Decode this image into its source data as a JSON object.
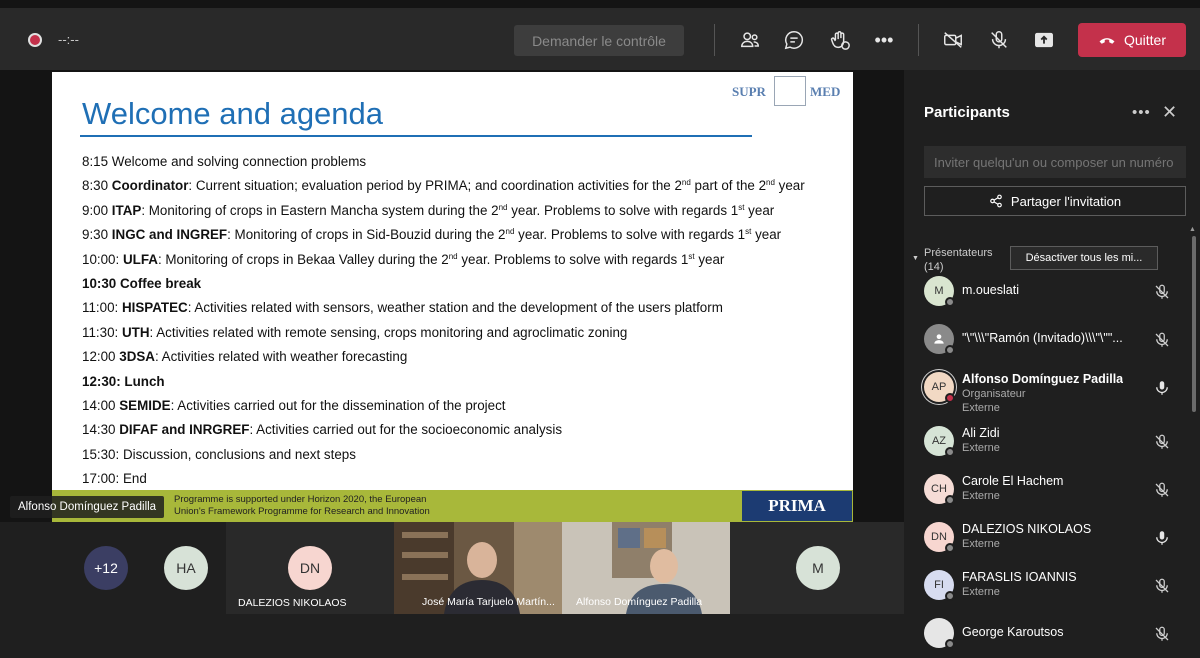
{
  "toolbar": {
    "timer": "--:--",
    "request_control_label": "Demander le contrôle",
    "quit_label": "Quitter",
    "icons": [
      "participants-icon",
      "chat-icon",
      "reactions-icon",
      "more-icon",
      "camera-off-icon",
      "mic-off-icon",
      "share-tray-icon",
      "hangup-icon"
    ]
  },
  "slide": {
    "title": "Welcome and agenda",
    "logo_left": "SUPR",
    "logo_right": "MED",
    "agenda": [
      {
        "time": "8:15",
        "bold": "",
        "text": " Welcome and solving connection problems"
      },
      {
        "time": "8:30",
        "bold": "Coordinator",
        "text": ": Current situation; evaluation period by PRIMA; and coordination activities for the 2nd part of the 2nd year"
      },
      {
        "time": "9:00",
        "bold": "ITAP",
        "text": ": Monitoring of crops in Eastern Mancha system during the 2nd year. Problems to solve with regards 1st year"
      },
      {
        "time": "9:30",
        "bold": "INGC and INGREF",
        "text": ": Monitoring of crops in Sid-Bouzid during the 2nd year. Problems to solve with regards 1st year"
      },
      {
        "time": "10:00:",
        "bold": "ULFA",
        "text": ": Monitoring of crops in Bekaa Valley during the 2nd year. Problems to solve with regards 1st year"
      },
      {
        "time": "",
        "bold": "10:30 Coffee break",
        "text": ""
      },
      {
        "time": "11:00:",
        "bold": "HISPATEC",
        "text": ": Activities related with sensors, weather station and the development of the users platform"
      },
      {
        "time": "11:30:",
        "bold": "UTH",
        "text": ":  Activities related with remote sensing, crops monitoring and agroclimatic zoning"
      },
      {
        "time": "12:00",
        "bold": "3DSA",
        "text": ": Activities related with weather forecasting"
      },
      {
        "time": "",
        "bold": "12:30: Lunch",
        "text": ""
      },
      {
        "time": "14:00",
        "bold": "SEMIDE",
        "text": ": Activities carried out for the dissemination of the project"
      },
      {
        "time": "14:30",
        "bold": "DIFAF and INRGREF",
        "text": ": Activities carried out for the socioeconomic analysis"
      },
      {
        "time": "15:30:",
        "bold": "",
        "text": " Discussion, conclusions and next steps"
      },
      {
        "time": "17:00:",
        "bold": "",
        "text": " End"
      }
    ],
    "footer_text_line1": "Programme is supported under Horizon 2020, the European",
    "footer_text_line2": "Union's Framework Programme for Research and Innovation",
    "footer_logo": "PRIMA",
    "presenter_name": "Alfonso Domínguez Padilla"
  },
  "strip": {
    "overflow_count": "+12",
    "tiles": [
      {
        "initials": "HA",
        "name": ""
      },
      {
        "initials": "DN",
        "name": "DALEZIOS NIKOLAOS"
      },
      {
        "initials": "",
        "name": "José María Tarjuelo Martín..."
      },
      {
        "initials": "",
        "name": "Alfonso Domínguez Padilla"
      },
      {
        "initials": "M",
        "name": ""
      }
    ]
  },
  "panel": {
    "title": "Participants",
    "more": "•••",
    "close": "✕",
    "invite_placeholder": "Inviter quelqu'un ou composer un numéro",
    "share_invite_label": "Partager l'invitation",
    "section_label": "Présentateurs",
    "section_count": "(14)",
    "mute_all_label": "Désactiver tous les mi...",
    "participants": [
      {
        "initials": "M",
        "name": "m.oueslati",
        "sub": "",
        "mic": "off",
        "avatar_color": "#d9e5d0"
      },
      {
        "initials": "",
        "name": "\"\\\"\\\\\\\"Ramón (Invitado)\\\\\\\"\\\"\"...",
        "sub": "",
        "mic": "off",
        "avatar_color": "#8a8a8a"
      },
      {
        "initials": "AP",
        "name": "Alfonso Domínguez Padilla",
        "sub": "Organisateur",
        "sub2": "Externe",
        "mic": "on",
        "avatar_color": "#f2d9c4"
      },
      {
        "initials": "AZ",
        "name": "Ali Zidi",
        "sub": "Externe",
        "mic": "off",
        "avatar_color": "#d6e4d6"
      },
      {
        "initials": "CH",
        "name": "Carole El Hachem",
        "sub": "Externe",
        "mic": "off",
        "avatar_color": "#f5dcd6"
      },
      {
        "initials": "DN",
        "name": "DALEZIOS NIKOLAOS",
        "sub": "Externe",
        "mic": "on",
        "avatar_color": "#f7d6d0"
      },
      {
        "initials": "FI",
        "name": "FARASLIS IOANNIS",
        "sub": "Externe",
        "mic": "off",
        "avatar_color": "#d7dcf0"
      },
      {
        "initials": "",
        "name": "George Karoutsos",
        "sub": "",
        "mic": "off",
        "avatar_color": "#e6e6e6"
      }
    ]
  },
  "colors": {
    "accent_red": "#c4314b",
    "slide_blue": "#1f6fb5",
    "footer_green": "#a8b83a"
  }
}
